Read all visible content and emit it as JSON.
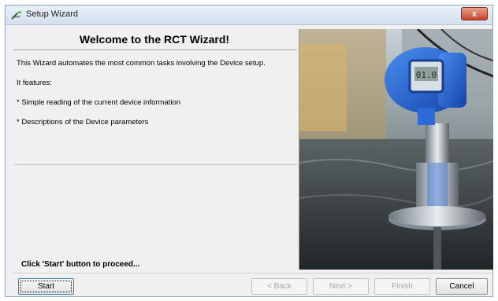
{
  "window": {
    "title": "Setup Wizard",
    "close_glyph": "x"
  },
  "content": {
    "heading": "Welcome to the RCT Wizard!",
    "intro": "This Wizard automates the most common tasks involving the Device setup.",
    "features_label": "It features:",
    "features": [
      "* Simple reading of the current device information",
      "* Descriptions of the Device parameters"
    ],
    "proceed_hint": "Click 'Start' button to proceed..."
  },
  "buttons": {
    "start": "Start",
    "back": "< Back",
    "next": "Next >",
    "finish": "Finish",
    "cancel": "Cancel"
  },
  "icons": {
    "app": "wizard-wand-icon",
    "close": "close-icon"
  },
  "colors": {
    "device_blue": "#1f63d6",
    "close_red": "#c7452b"
  }
}
